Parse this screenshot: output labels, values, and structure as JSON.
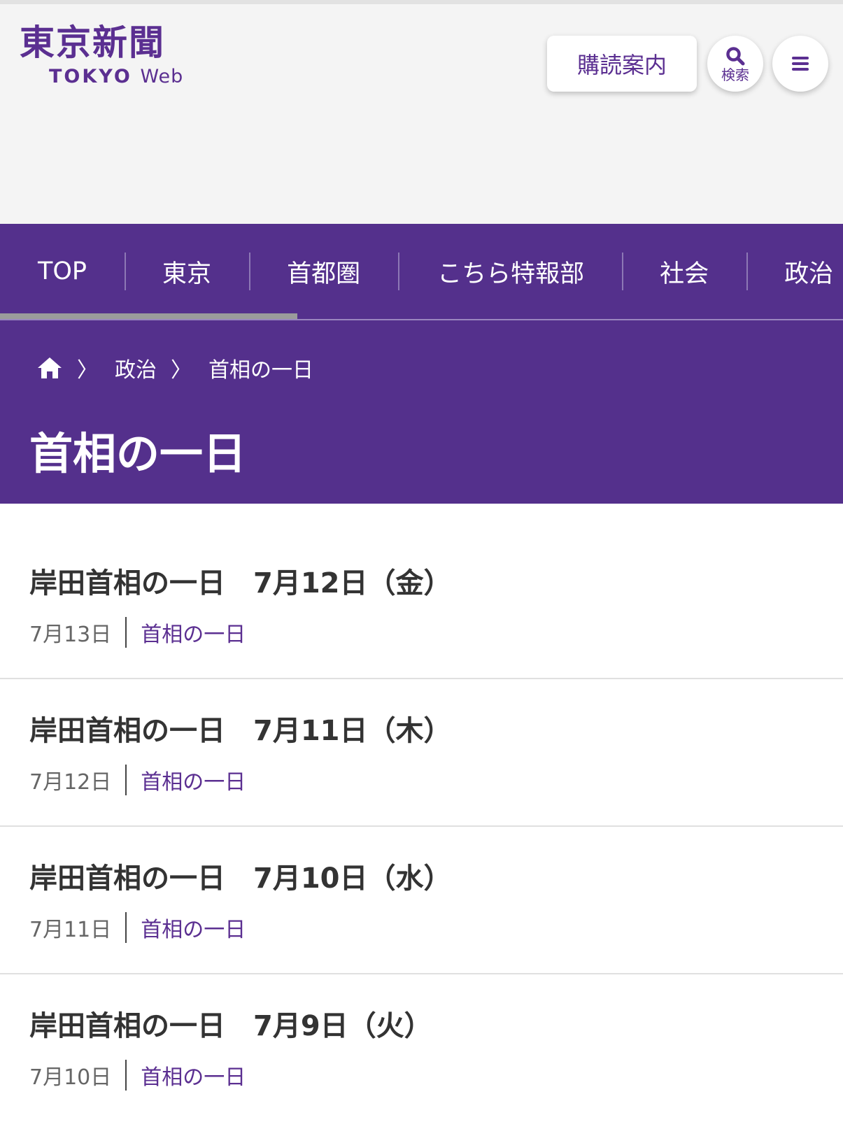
{
  "header": {
    "logo_kanji": "東京新聞",
    "logo_sub_bold": "TOKYO",
    "logo_sub_light": "Web",
    "subscribe_label": "購読案内",
    "search_label": "検索",
    "icons": {
      "search": "magnifier-icon",
      "menu": "hamburger-icon"
    }
  },
  "nav": {
    "items": [
      {
        "label": "TOP",
        "active": true
      },
      {
        "label": "東京"
      },
      {
        "label": "首都圏"
      },
      {
        "label": "こちら特報部"
      },
      {
        "label": "社会"
      },
      {
        "label": "政治"
      }
    ]
  },
  "breadcrumb": {
    "home_icon": "home-icon",
    "items": [
      "政治",
      "首相の一日"
    ]
  },
  "page_title": "首相の一日",
  "articles": [
    {
      "title": "岸田首相の一日　7月12日（金）",
      "date": "7月13日",
      "category": "首相の一日"
    },
    {
      "title": "岸田首相の一日　7月11日（木）",
      "date": "7月12日",
      "category": "首相の一日"
    },
    {
      "title": "岸田首相の一日　7月10日（水）",
      "date": "7月11日",
      "category": "首相の一日"
    },
    {
      "title": "岸田首相の一日　7月9日（火）",
      "date": "7月10日",
      "category": "首相の一日"
    }
  ],
  "colors": {
    "brand_purple": "#54308c",
    "link_purple": "#5b2f91",
    "header_bg": "#f4f4f4"
  }
}
